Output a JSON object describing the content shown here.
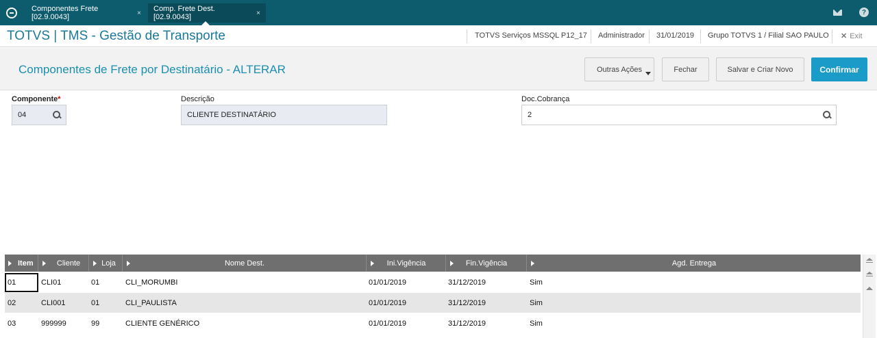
{
  "tabs": [
    {
      "label": "Componentes Frete [02.9.0043]",
      "close": "×"
    },
    {
      "label": "Comp. Frete Dest. [02.9.0043]",
      "close": "×"
    }
  ],
  "app": {
    "title": "TOTVS | TMS - Gestão de Transporte",
    "environment": "TOTVS Serviços MSSQL P12_17",
    "user": "Administrador",
    "date": "31/01/2019",
    "branch": "Grupo TOTVS 1 / Filial SAO PAULO",
    "exit_label": "Exit",
    "exit_glyph": "✕"
  },
  "form": {
    "title": "Componentes de Frete por Destinatário - ALTERAR",
    "buttons": {
      "outras": "Outras Ações",
      "fechar": "Fechar",
      "salvar": "Salvar e Criar Novo",
      "confirmar": "Confirmar"
    },
    "fields": {
      "componente_label": "Componente",
      "componente_required": "*",
      "componente_value": "04",
      "descricao_label": "Descrição",
      "descricao_value": "CLIENTE DESTINATÁRIO",
      "doc_label": "Doc.Cobrança",
      "doc_value": "2"
    }
  },
  "grid": {
    "columns": [
      "Item",
      "Cliente",
      "Loja",
      "Nome Dest.",
      "Ini.Vigência",
      "Fin.Vigência",
      "Agd. Entrega"
    ],
    "rows": [
      {
        "item": "01",
        "cliente": "CLI01",
        "loja": "01",
        "nome": "CLI_MORUMBI",
        "ini": "01/01/2019",
        "fin": "31/12/2019",
        "agd": "Sim"
      },
      {
        "item": "02",
        "cliente": "CLI001",
        "loja": "01",
        "nome": "CLI_PAULISTA",
        "ini": "01/01/2019",
        "fin": "31/12/2019",
        "agd": "Sim"
      },
      {
        "item": "03",
        "cliente": "999999",
        "loja": "99",
        "nome": "CLIENTE GENÉRICO",
        "ini": "01/01/2019",
        "fin": "31/12/2019",
        "agd": "Sim"
      }
    ]
  },
  "colors": {
    "tabbar": "#0d5c6e",
    "accent": "#1b8fb0",
    "confirm": "#1a9bc8",
    "grid_header": "#6f6f6f"
  }
}
